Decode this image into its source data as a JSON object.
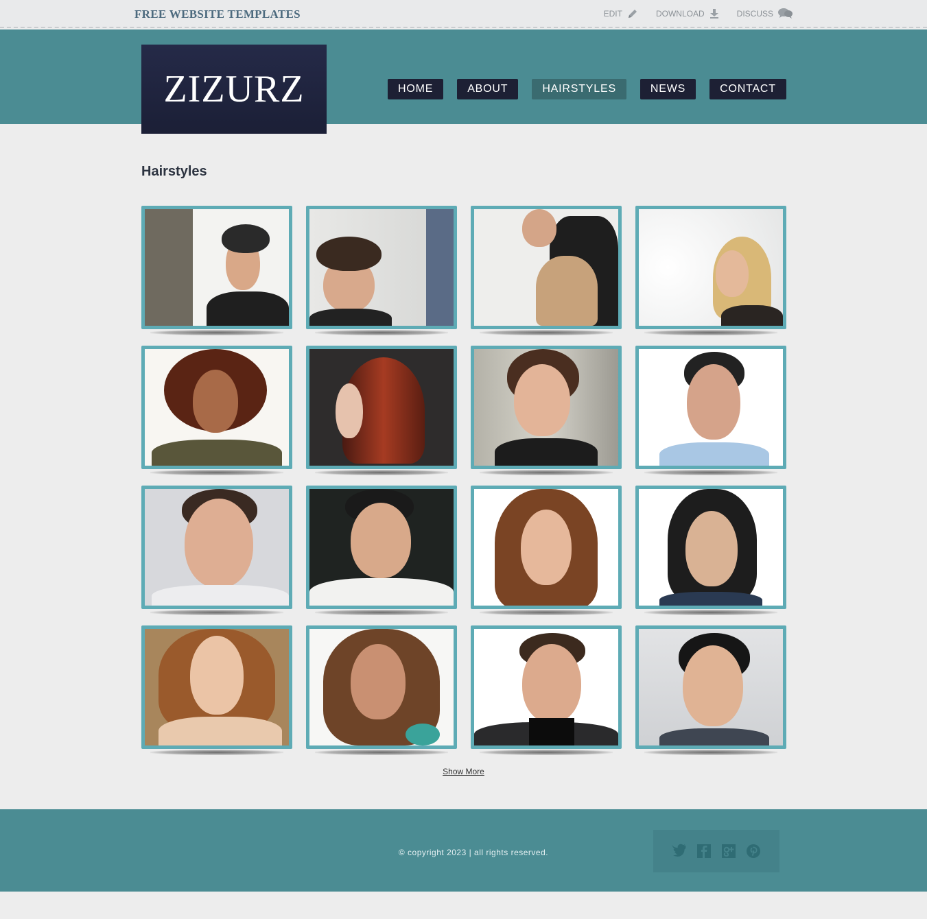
{
  "topbar": {
    "brand": "FREE WEBSITE TEMPLATES",
    "links": [
      {
        "label": "EDIT",
        "icon": "pencil-icon"
      },
      {
        "label": "DOWNLOAD",
        "icon": "download-icon"
      },
      {
        "label": "DISCUSS",
        "icon": "speech-bubbles-icon"
      }
    ]
  },
  "header": {
    "logo": "ZIZURZ",
    "nav": [
      "HOME",
      "ABOUT",
      "HAIRSTYLES",
      "NEWS",
      "CONTACT"
    ],
    "active_nav": "HAIRSTYLES"
  },
  "main": {
    "title": "Hairstyles",
    "show_more": "Show More",
    "gallery_count": 16
  },
  "footer": {
    "copyright": "© copyright 2023 | all rights reserved.",
    "social": [
      "twitter-icon",
      "facebook-icon",
      "google-plus-icon",
      "pinterest-icon"
    ]
  },
  "colors": {
    "header_bg": "#4b8c93",
    "nav_bg": "#1d2034",
    "nav_active_bg": "#3a6b70",
    "logo_bg": "#1f2340",
    "thumb_border": "#5eabb5",
    "page_bg": "#ededed"
  }
}
